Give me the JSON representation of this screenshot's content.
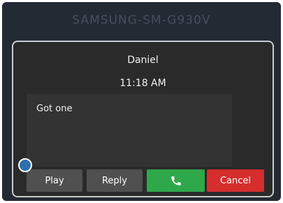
{
  "device": {
    "title": "SAMSUNG-SM-G930V"
  },
  "dialog": {
    "caller_name": "Daniel",
    "time": "11:18 AM",
    "message": "Got one",
    "buttons": {
      "play_label": "Play",
      "reply_label": "Reply",
      "call_icon": "phone-icon",
      "cancel_label": "Cancel"
    }
  },
  "colors": {
    "frame_background": "#232a33",
    "dialog_background": "#2a2a2a",
    "message_background": "#333333",
    "button_gray": "#505050",
    "button_call": "#2ea84a",
    "button_cancel": "#d62d2d",
    "marker_blue": "#2d6fb1"
  }
}
